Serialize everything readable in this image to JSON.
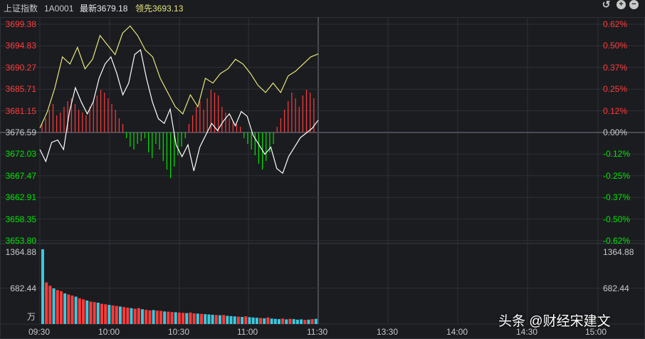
{
  "header": {
    "index_name": "上证指数",
    "code": "1A0001",
    "latest": "最新3679.18",
    "leading": "领先3693.13",
    "tools": [
      {
        "icon": "undo-icon",
        "glyph": "↺"
      },
      {
        "icon": "zoom-in-icon",
        "glyph": "+"
      },
      {
        "icon": "zoom-out-icon",
        "glyph": "−"
      }
    ]
  },
  "price_axis": {
    "left": [
      "3699.38",
      "3694.83",
      "3690.27",
      "3685.71",
      "3681.15",
      "3676.59",
      "3672.03",
      "3667.47",
      "3662.91",
      "3658.35",
      "3653.80"
    ],
    "right": [
      "0.62%",
      "0.50%",
      "0.37%",
      "0.25%",
      "0.12%",
      "0.00%",
      "-0.12%",
      "-0.25%",
      "-0.37%",
      "-0.50%",
      "-0.62%"
    ],
    "prev_close": 3676.59,
    "min": 3653.8,
    "max": 3699.38
  },
  "volume_axis": {
    "labels": [
      "1364.88",
      "682.44"
    ],
    "unit": "万",
    "max": 1364.88
  },
  "time_axis": [
    "09:30",
    "10:00",
    "10:30",
    "11:00",
    "11:30",
    "13:30",
    "14:00",
    "14:30",
    "15:00"
  ],
  "watermark": "头条 @财经宋建文",
  "colors": {
    "up": "#ff3b3b",
    "down": "#00e600",
    "price_line": "#ffffff",
    "leading_line": "#e6e67a",
    "volume_up": "#ff3b3b",
    "volume_down": "#3cc8dc",
    "grid": "#2e3036"
  },
  "chart_data": {
    "type": "line",
    "title": "上证指数",
    "x_range": [
      "09:30",
      "15:00"
    ],
    "x_ticks": [
      "09:30",
      "10:00",
      "10:30",
      "11:00",
      "11:30",
      "13:30",
      "14:00",
      "14:30",
      "15:00"
    ],
    "ylim": [
      3653.8,
      3699.38
    ],
    "series": [
      {
        "name": "最新",
        "values": [
          3673.0,
          3670.5,
          3674.5,
          3675.0,
          3673.0,
          3681.0,
          3686.0,
          3683.0,
          3680.5,
          3683.0,
          3688.0,
          3691.0,
          3692.5,
          3689.0,
          3684.5,
          3687.0,
          3693.0,
          3694.0,
          3688.0,
          3683.0,
          3679.5,
          3678.5,
          3681.5,
          3674.0,
          3671.5,
          3674.0,
          3668.5,
          3673.5,
          3676.0,
          3678.5,
          3677.0,
          3679.0,
          3680.5,
          3678.0,
          3681.0,
          3680.0,
          3676.0,
          3674.0,
          3672.0,
          3673.5,
          3669.0,
          3668.0,
          3671.5,
          3673.5,
          3675.5,
          3676.5,
          3677.5,
          3679.18
        ]
      },
      {
        "name": "领先",
        "values": [
          3677.5,
          3681.0,
          3686.0,
          3692.5,
          3691.0,
          3694.5,
          3690.0,
          3692.0,
          3697.0,
          3695.0,
          3693.0,
          3697.5,
          3699.0,
          3697.0,
          3694.0,
          3692.5,
          3688.0,
          3685.0,
          3682.0,
          3680.5,
          3684.5,
          3682.0,
          3688.0,
          3687.0,
          3689.0,
          3690.0,
          3692.0,
          3691.0,
          3689.0,
          3686.5,
          3685.0,
          3687.0,
          3685.0,
          3688.5,
          3689.5,
          3691.0,
          3692.5,
          3693.13
        ]
      }
    ],
    "bars": {
      "name": "涨跌柱",
      "values": [
        3,
        5,
        8,
        10,
        6,
        7,
        9,
        11,
        12,
        10,
        8,
        7,
        6,
        9,
        11,
        13,
        15,
        14,
        12,
        10,
        8,
        5,
        3,
        -2,
        -5,
        -6,
        -4,
        -3,
        -2,
        -7,
        -9,
        -4,
        -6,
        -10,
        -13,
        -16,
        -12,
        -8,
        -5,
        -2,
        3,
        6,
        9,
        11,
        8,
        12,
        15,
        14,
        13,
        9,
        7,
        5,
        4,
        3,
        2,
        -2,
        -4,
        -6,
        -8,
        -11,
        -13,
        -10,
        -7,
        -4,
        2,
        5,
        8,
        11,
        14,
        12,
        9,
        13,
        15,
        14,
        12
      ]
    },
    "volume": {
      "unit": "万",
      "ylim": [
        0,
        1364.88
      ],
      "values": [
        1364.88,
        760,
        700,
        650,
        620,
        600,
        560,
        540,
        520,
        500,
        470,
        450,
        430,
        410,
        400,
        390,
        370,
        360,
        350,
        340,
        330,
        320,
        310,
        300,
        290,
        280,
        290,
        270,
        260,
        250,
        255,
        245,
        240,
        230,
        225,
        220,
        215,
        210,
        205,
        200,
        210,
        195,
        190,
        185,
        180,
        175,
        170,
        165,
        160,
        165,
        150,
        145,
        140,
        135,
        130,
        140,
        125,
        120,
        115,
        110,
        105,
        120,
        100,
        95,
        90,
        100,
        85,
        95,
        90,
        80,
        85,
        75,
        80,
        90,
        95
      ]
    }
  }
}
